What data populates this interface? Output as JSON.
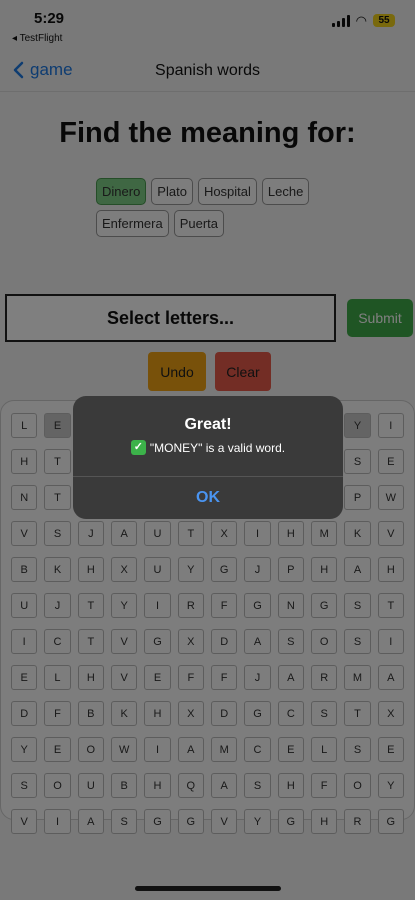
{
  "status": {
    "time": "5:29",
    "back_app": "◂ TestFlight",
    "battery": "55"
  },
  "nav": {
    "back_label": "game",
    "title": "Spanish words"
  },
  "heading": "Find the meaning for:",
  "words": [
    {
      "label": "Dinero",
      "selected": true
    },
    {
      "label": "Plato",
      "selected": false
    },
    {
      "label": "Hospital",
      "selected": false
    },
    {
      "label": "Leche",
      "selected": false
    },
    {
      "label": "Enfermera",
      "selected": false
    },
    {
      "label": "Puerta",
      "selected": false
    }
  ],
  "input_placeholder": "Select letters...",
  "buttons": {
    "submit": "Submit",
    "undo": "Undo",
    "clear": "Clear"
  },
  "grid": [
    [
      "L",
      "E",
      "",
      "",
      "",
      "",
      "",
      "",
      "",
      "",
      "Y",
      "I"
    ],
    [
      "H",
      "T",
      "",
      "",
      "",
      "",
      "",
      "",
      "",
      "",
      "S",
      "E"
    ],
    [
      "N",
      "T",
      "",
      "",
      "",
      "",
      "",
      "",
      "",
      "",
      "P",
      "W"
    ],
    [
      "V",
      "S",
      "J",
      "A",
      "U",
      "T",
      "X",
      "I",
      "H",
      "M",
      "K",
      "V"
    ],
    [
      "B",
      "K",
      "H",
      "X",
      "U",
      "Y",
      "G",
      "J",
      "P",
      "H",
      "A",
      "H"
    ],
    [
      "U",
      "J",
      "T",
      "Y",
      "I",
      "R",
      "F",
      "G",
      "N",
      "G",
      "S",
      "T"
    ],
    [
      "I",
      "C",
      "T",
      "V",
      "G",
      "X",
      "D",
      "A",
      "S",
      "O",
      "S",
      "I"
    ],
    [
      "E",
      "L",
      "H",
      "V",
      "E",
      "F",
      "F",
      "J",
      "A",
      "R",
      "M",
      "A"
    ],
    [
      "D",
      "F",
      "B",
      "K",
      "H",
      "X",
      "D",
      "G",
      "C",
      "S",
      "T",
      "X"
    ],
    [
      "Y",
      "E",
      "O",
      "W",
      "I",
      "A",
      "M",
      "C",
      "E",
      "L",
      "S",
      "E"
    ],
    [
      "S",
      "O",
      "U",
      "B",
      "H",
      "Q",
      "A",
      "S",
      "H",
      "F",
      "O",
      "Y"
    ],
    [
      "V",
      "I",
      "A",
      "S",
      "G",
      "G",
      "V",
      "Y",
      "G",
      "H",
      "R",
      "G"
    ]
  ],
  "highlighted": [
    [
      0,
      1
    ],
    [
      0,
      10
    ]
  ],
  "alert": {
    "title": "Great!",
    "check": "✓",
    "message": "\"MONEY\" is a valid word.",
    "ok": "OK"
  }
}
